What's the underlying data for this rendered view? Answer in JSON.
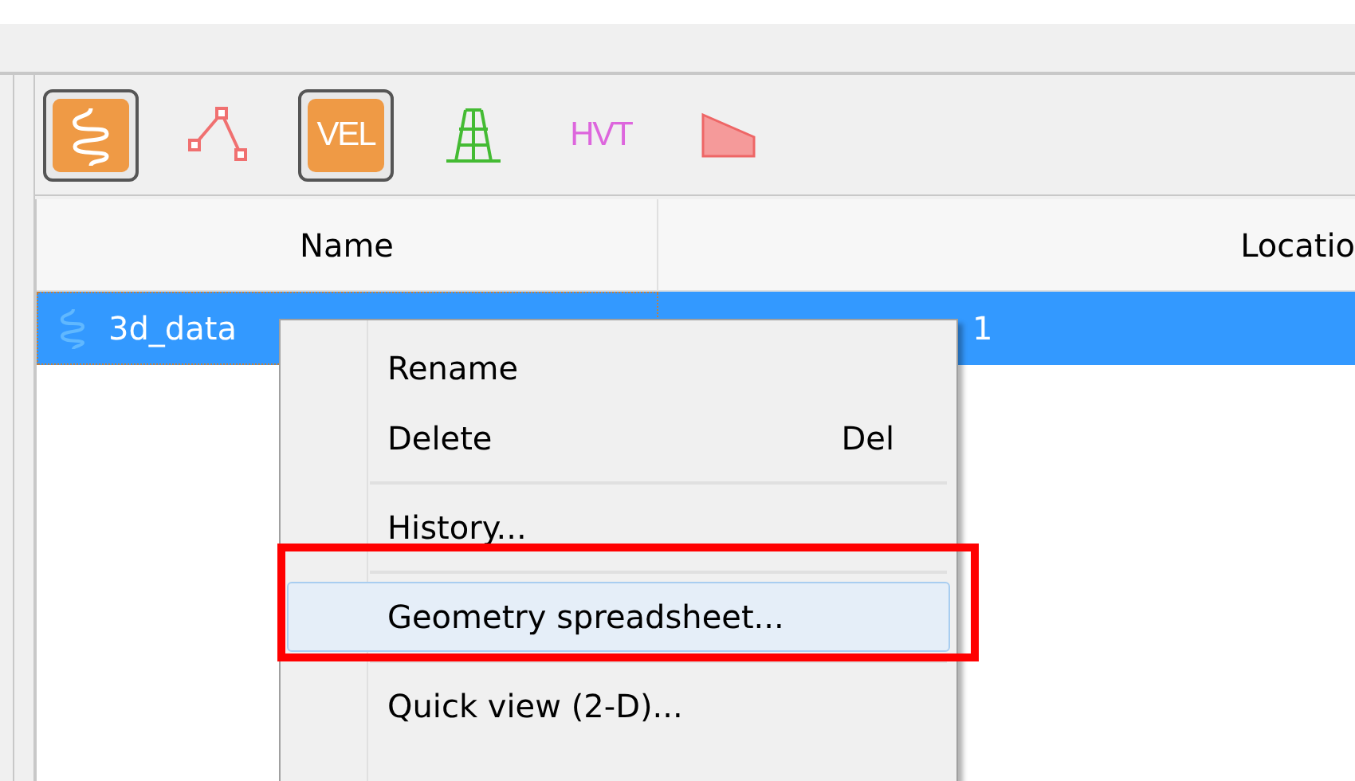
{
  "toolbar": [
    {
      "kind": "wave",
      "selected": true
    },
    {
      "kind": "polyline",
      "selected": false
    },
    {
      "kind": "text",
      "label": "VEL",
      "color": "#ffffff",
      "selected": true
    },
    {
      "kind": "tower",
      "selected": false
    },
    {
      "kind": "text",
      "label": "HVT",
      "color": "#dd66dd",
      "selected": false
    },
    {
      "kind": "wedge",
      "selected": false
    }
  ],
  "table": {
    "columns": [
      "Name",
      "Locatio"
    ],
    "rows": [
      {
        "name": "3d_data",
        "location": "1",
        "selected": true
      }
    ]
  },
  "context_menu": {
    "items": [
      {
        "kind": "item",
        "label": "Rename",
        "selected": false
      },
      {
        "kind": "item",
        "label": "Delete",
        "shortcut": "Del",
        "selected": false
      },
      {
        "kind": "separator"
      },
      {
        "kind": "item",
        "label": "History...",
        "selected": false
      },
      {
        "kind": "separator"
      },
      {
        "kind": "item",
        "label": "Geometry spreadsheet...",
        "selected": true,
        "highlighted_by_annotation": true
      },
      {
        "kind": "separator"
      },
      {
        "kind": "item",
        "label": "Quick view (2-D)...",
        "selected": false
      }
    ]
  }
}
